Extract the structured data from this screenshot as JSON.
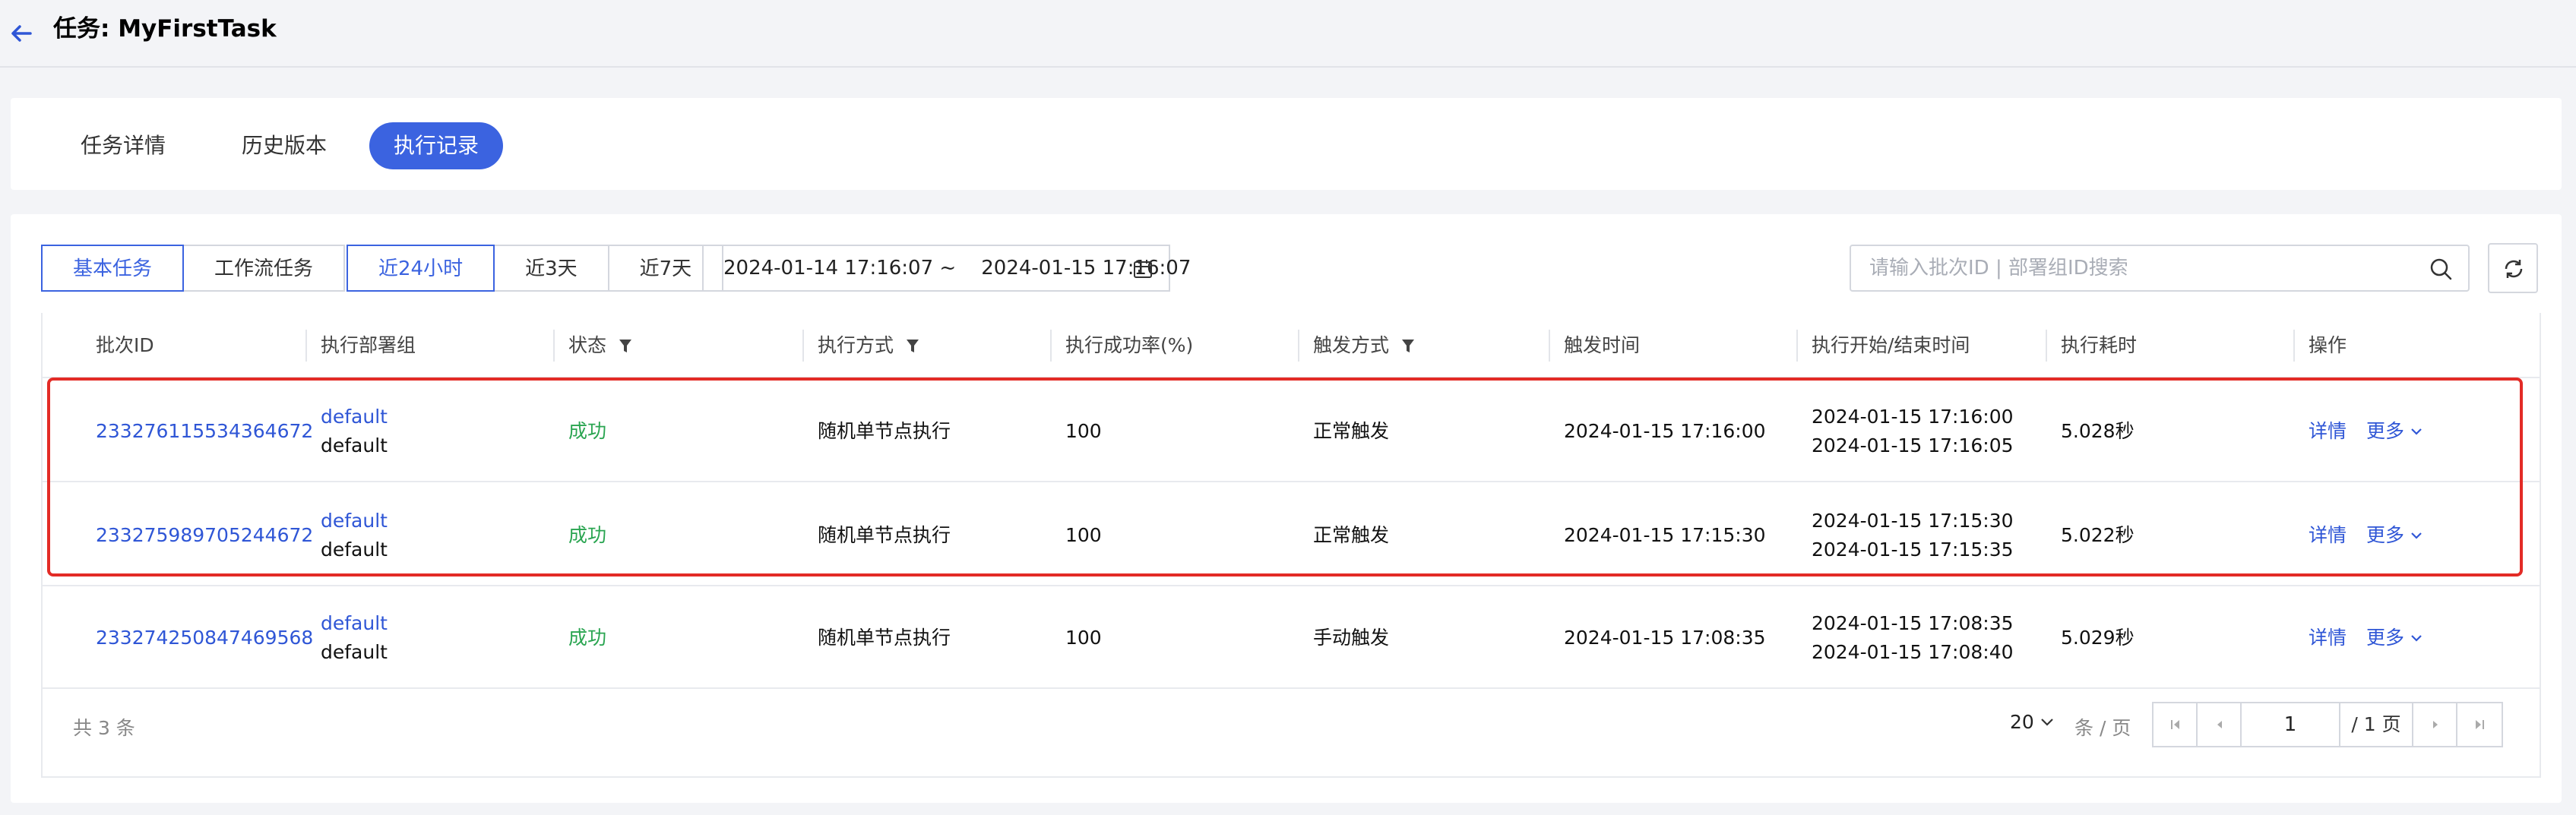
{
  "header": {
    "title": "任务: MyFirstTask"
  },
  "tabs": [
    {
      "label": "任务详情"
    },
    {
      "label": "历史版本"
    },
    {
      "label": "执行记录",
      "active": true
    }
  ],
  "filters": {
    "task_type": [
      {
        "label": "基本任务",
        "active": true
      },
      {
        "label": "工作流任务"
      }
    ],
    "time_range": [
      {
        "label": "近24小时",
        "active": true
      },
      {
        "label": "近3天"
      },
      {
        "label": "近7天"
      }
    ],
    "date_range": "2024-01-14 17:16:07 ~    2024-01-15 17:16:07",
    "search_placeholder": "请输入批次ID | 部署组ID搜索"
  },
  "table": {
    "columns": [
      {
        "label": "批次ID"
      },
      {
        "label": "执行部署组"
      },
      {
        "label": "状态",
        "filter": true
      },
      {
        "label": "执行方式",
        "filter": true
      },
      {
        "label": "执行成功率(%)"
      },
      {
        "label": "触发方式",
        "filter": true
      },
      {
        "label": "触发时间"
      },
      {
        "label": "执行开始/结束时间"
      },
      {
        "label": "执行耗时"
      },
      {
        "label": "操作"
      }
    ],
    "rows": [
      {
        "id": "233276115534364672",
        "group_link": "default",
        "group": "default",
        "status": "成功",
        "mode": "随机单节点执行",
        "rate": "100",
        "trigger": "正常触发",
        "time": "2024-01-15 17:16:00",
        "start": "2024-01-15 17:16:00",
        "end": "2024-01-15 17:16:05",
        "duration": "5.028秒"
      },
      {
        "id": "233275989705244672",
        "group_link": "default",
        "group": "default",
        "status": "成功",
        "mode": "随机单节点执行",
        "rate": "100",
        "trigger": "正常触发",
        "time": "2024-01-15 17:15:30",
        "start": "2024-01-15 17:15:30",
        "end": "2024-01-15 17:15:35",
        "duration": "5.022秒"
      },
      {
        "id": "233274250847469568",
        "group_link": "default",
        "group": "default",
        "status": "成功",
        "mode": "随机单节点执行",
        "rate": "100",
        "trigger": "手动触发",
        "time": "2024-01-15 17:08:35",
        "start": "2024-01-15 17:08:35",
        "end": "2024-01-15 17:08:40",
        "duration": "5.029秒"
      }
    ],
    "actions": {
      "detail": "详情",
      "more": "更多"
    }
  },
  "footer": {
    "total": "共 3 条",
    "page_size": "20",
    "page_size_unit": "条 / 页",
    "page": "1",
    "page_total": "/ 1 页"
  },
  "colors": {
    "primary": "#3b63e0",
    "link": "#2f56d6",
    "success": "#2aa551",
    "highlight": "#e32b26"
  }
}
